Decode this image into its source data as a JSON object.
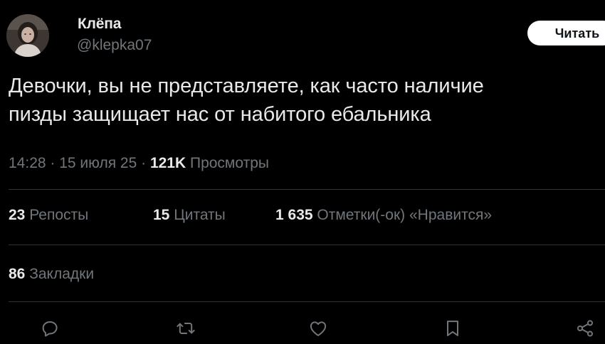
{
  "author": {
    "display_name": "Клёпа",
    "handle": "@klepka07"
  },
  "follow_button": {
    "label": "Читать"
  },
  "tweet": {
    "text": "Девочки, вы не представляете, как часто наличие\nпизды защищает нас от набитого ебальника"
  },
  "meta": {
    "time": "14:28",
    "sep1": " · ",
    "date": "15 июля 25",
    "sep2": " · ",
    "views_count": "121K",
    "views_label": " Просмотры"
  },
  "stats": {
    "reposts_count": "23",
    "reposts_label": " Репосты",
    "quotes_count": "15",
    "quotes_label": " Цитаты",
    "likes_count": "1 635",
    "likes_label": " Отметки(-ок) «Нравится»",
    "bookmarks_count": "86",
    "bookmarks_label": " Закладки"
  },
  "actions": {
    "reply_icon": "reply-icon",
    "repost_icon": "repost-icon",
    "like_icon": "like-icon",
    "bookmark_icon": "bookmark-icon",
    "share_icon": "share-icon"
  },
  "colors": {
    "background": "#000000",
    "primary_text": "#e7e9ea",
    "secondary_text": "#71767b",
    "divider": "#2f3336",
    "button_bg": "#ffffff",
    "button_text": "#0f1419"
  }
}
